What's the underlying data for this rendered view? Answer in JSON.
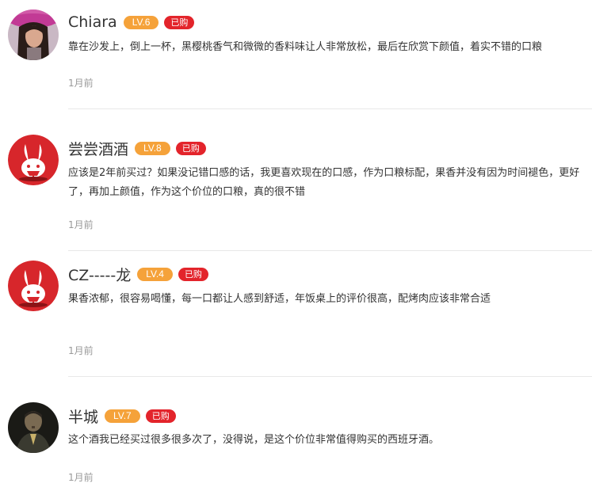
{
  "reviews": [
    {
      "username": "Chiara",
      "level": "LV.6",
      "badge": "已购",
      "avatar": "woman-portrait-avatar",
      "content": "靠在沙发上，倒上一杯，黑樱桃香气和微微的香料味让人非常放松，最后在欣赏下颜值，着实不错的口粮",
      "time": "1月前"
    },
    {
      "username": "尝尝酒酒",
      "level": "LV.8",
      "badge": "已购",
      "avatar": "rabbit-logo-avatar",
      "content": "应该是2年前买过？如果没记错口感的话，我更喜欢现在的口感，作为口粮标配，果香并没有因为时间褪色，更好了，再加上颜值，作为这个价位的口粮，真的很不错",
      "time": "1月前"
    },
    {
      "username": "CZ-----龙",
      "level": "LV.4",
      "badge": "已购",
      "avatar": "rabbit-logo-avatar",
      "content": "果香浓郁，很容易喝懂，每一口都让人感到舒适，年饭桌上的评价很高，配烤肉应该非常合适",
      "time": "1月前"
    },
    {
      "username": "半城",
      "level": "LV.7",
      "badge": "已购",
      "avatar": "man-portrait-avatar",
      "content": "这个酒我已经买过很多很多次了，没得说，是这个价位非常值得购买的西班牙酒。",
      "time": "1月前"
    }
  ],
  "colors": {
    "level_badge": "#f5a23a",
    "bought_badge": "#e3242b",
    "avatar_red": "#d7262b",
    "time_text": "#999999"
  }
}
